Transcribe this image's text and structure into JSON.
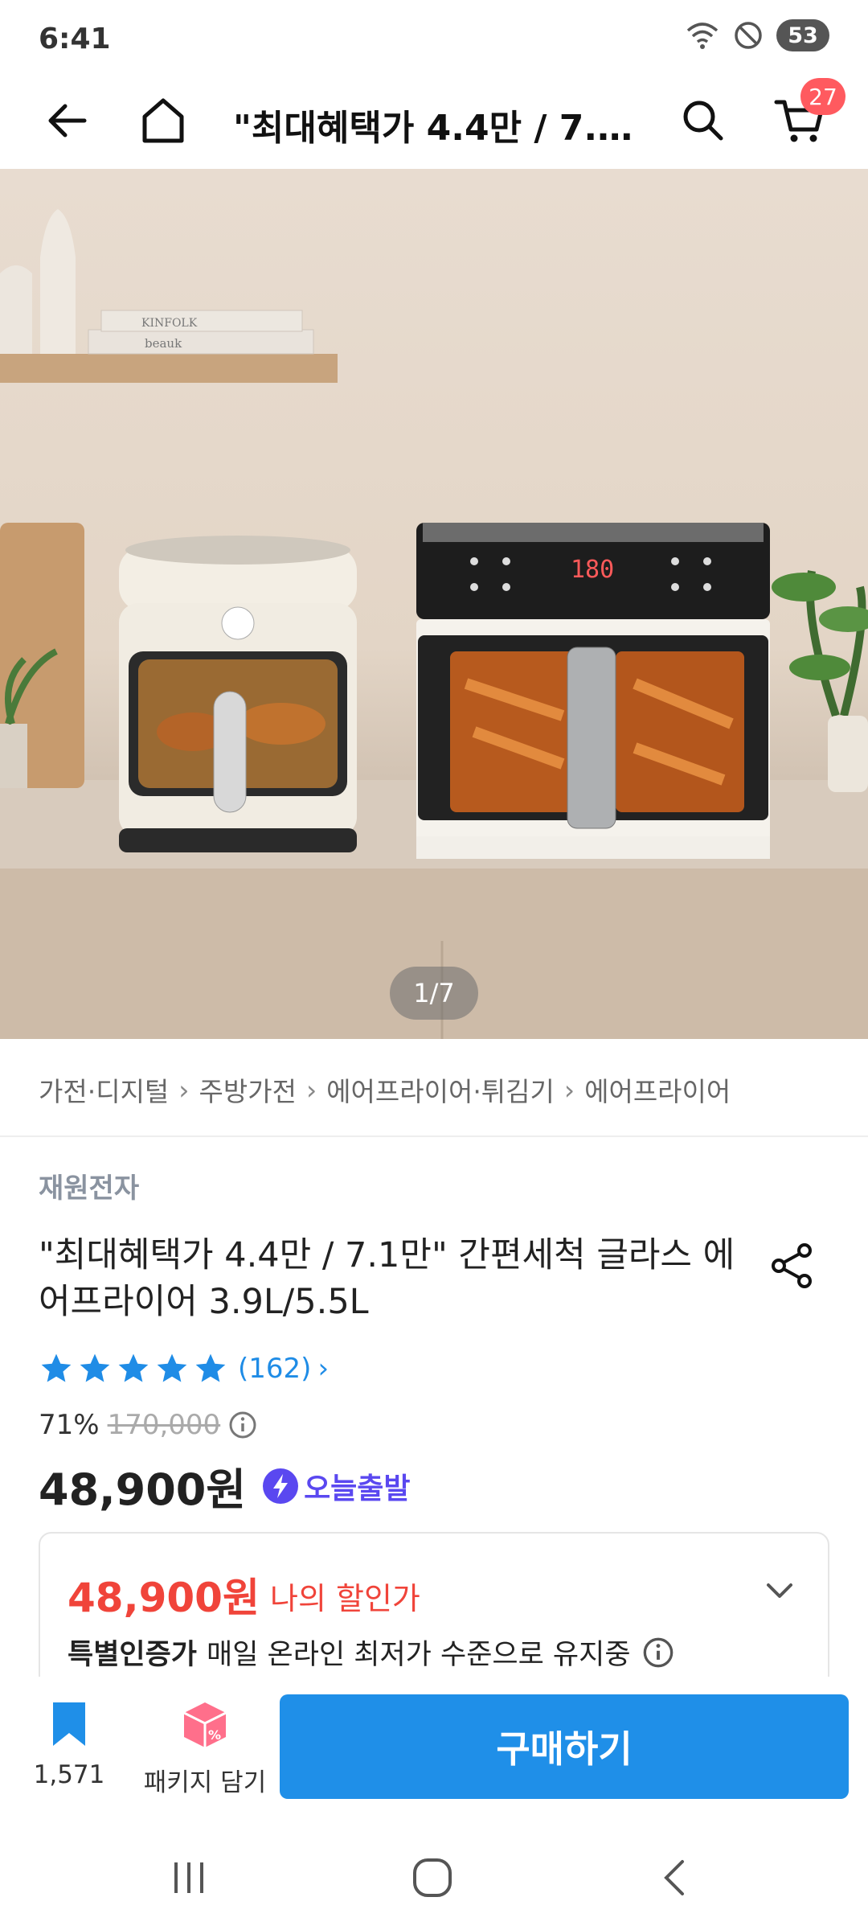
{
  "status": {
    "time": "6:41",
    "battery": "53"
  },
  "nav": {
    "title": "\"최대혜택가 4.4만 / 7.1만\" 간편세척 글라스 에어프라이어 3.9L/5.5L",
    "cart_count": "27"
  },
  "hero": {
    "counter": "1/7",
    "fryer_display": "180",
    "books": [
      "KINFOLK",
      "beauk"
    ]
  },
  "breadcrumb": [
    "가전·디지털",
    "주방가전",
    "에어프라이어·튀김기",
    "에어프라이어"
  ],
  "product": {
    "brand": "재원전자",
    "title": "\"최대혜택가 4.4만 / 7.1만\" 간편세척 글라스 에어프라이어 3.9L/5.5L",
    "rating": 5,
    "review_count": "(162)",
    "discount": "71%",
    "original_price": "170,000",
    "price": "48,900원",
    "badge": "오늘출발"
  },
  "my_discount": {
    "price": "48,900원",
    "label": "나의 할인가",
    "note_bold": "특별인증가",
    "note": "매일 온라인 최저가 수준으로 유지중"
  },
  "actions": {
    "wish_count": "1,571",
    "package_label": "패키지 담기",
    "buy_label": "구매하기"
  },
  "colors": {
    "accent": "#1f8fe8",
    "sale": "#f0443a",
    "star": "#1f8ce6",
    "badge": "#5a48f0"
  }
}
